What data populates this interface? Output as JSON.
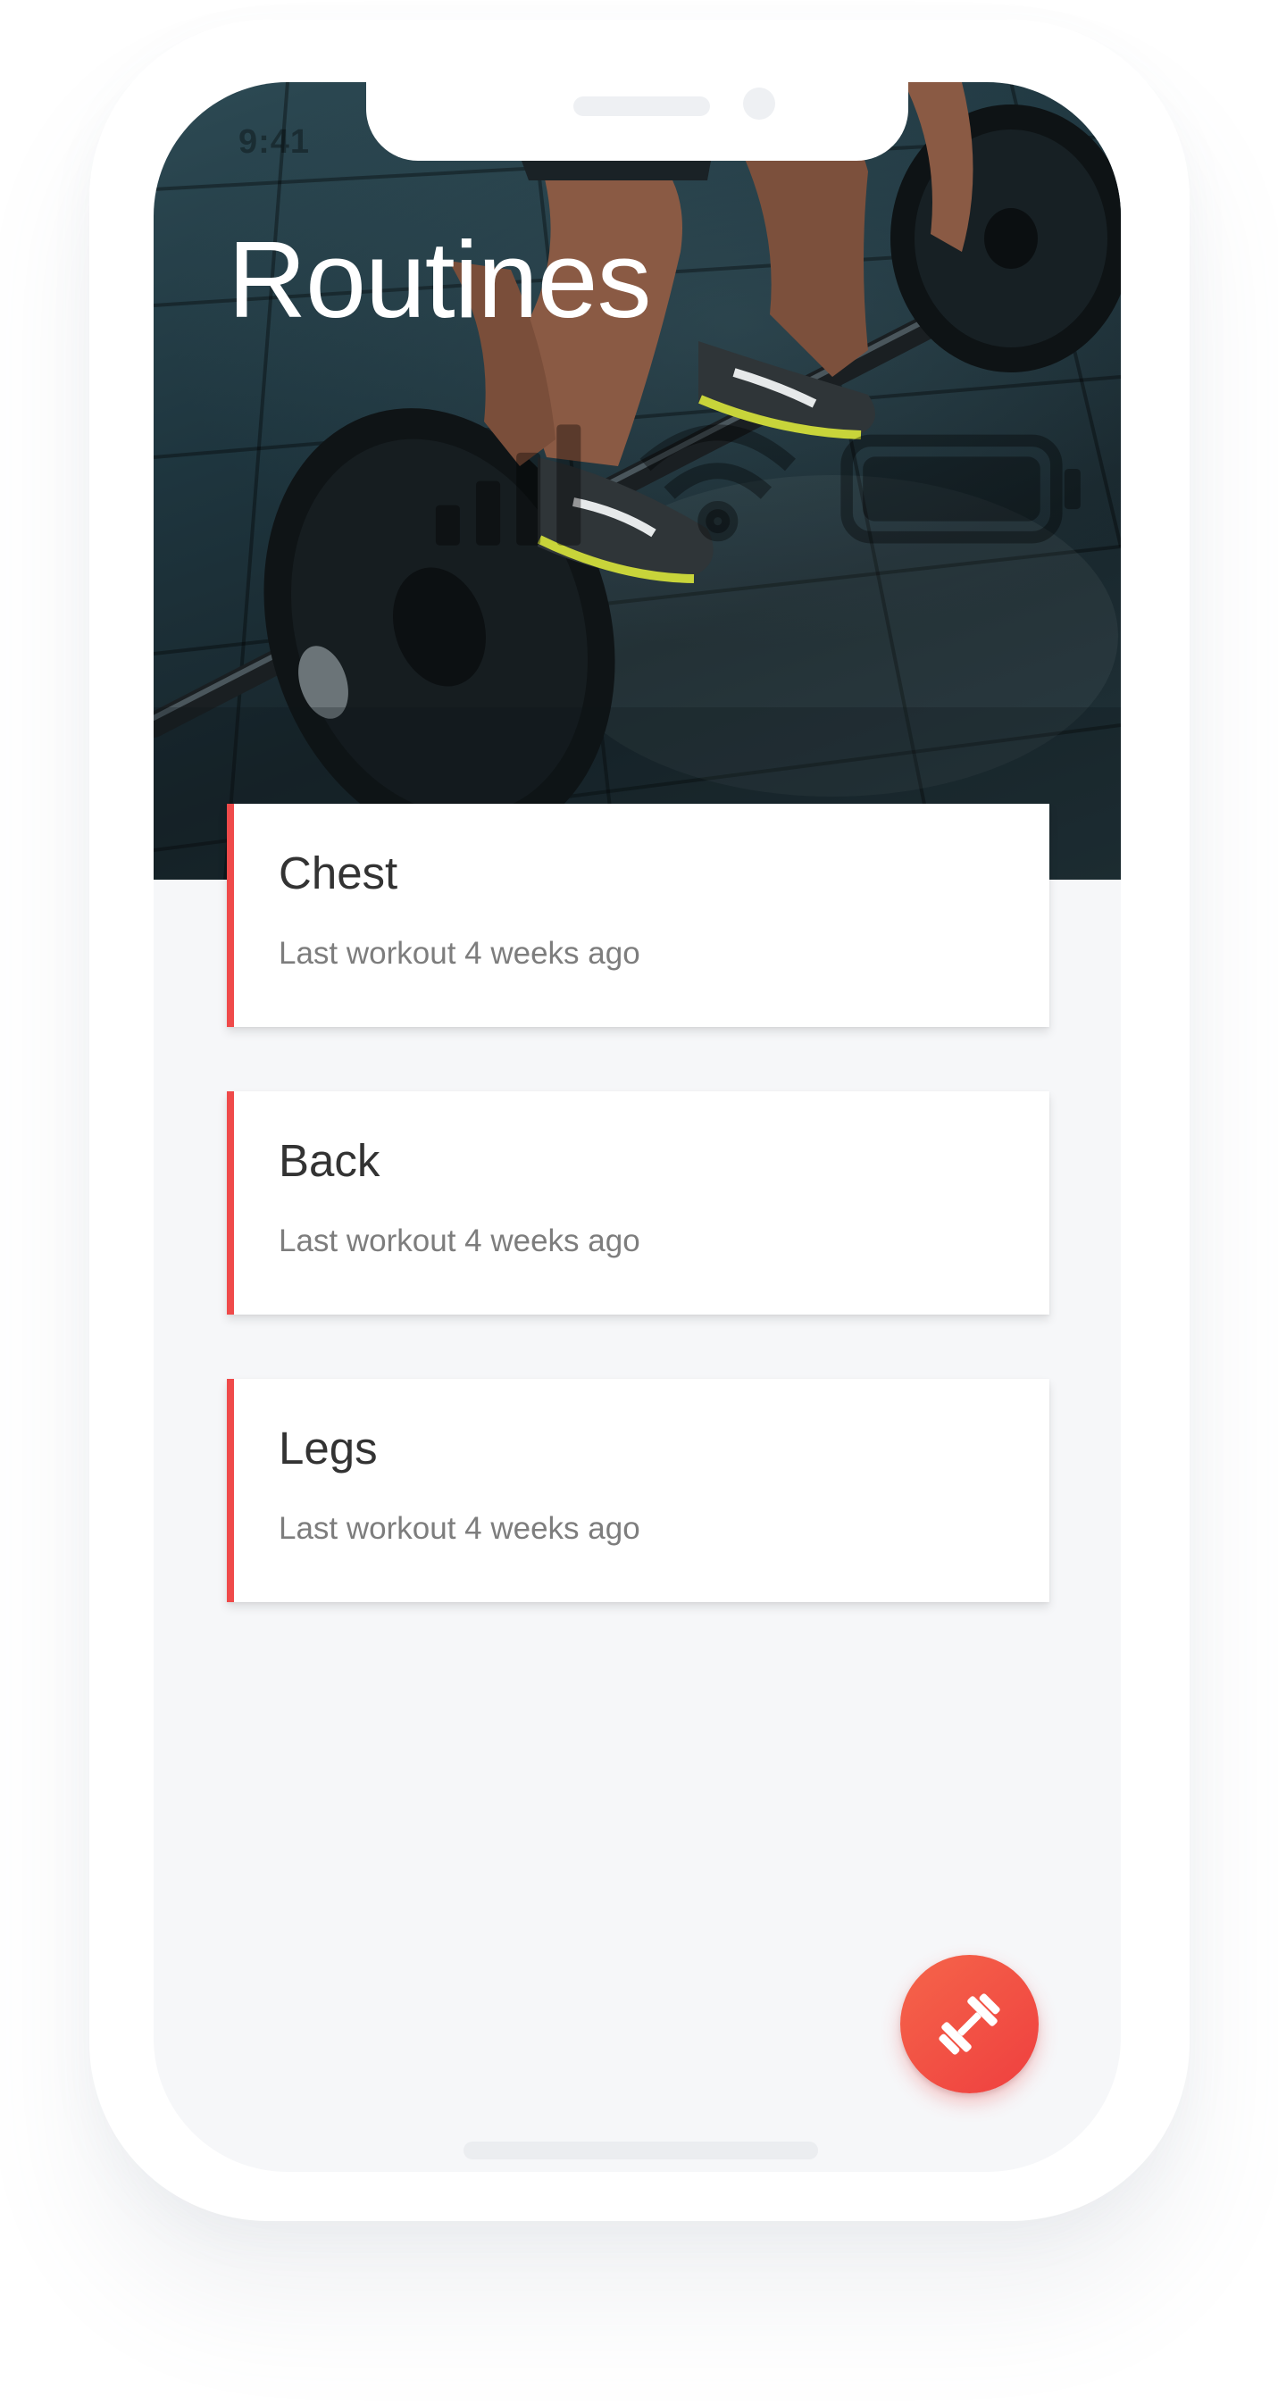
{
  "status_bar": {
    "time": "9:41"
  },
  "header": {
    "title": "Routines"
  },
  "routines": [
    {
      "name": "Chest",
      "last_workout": "Last workout 4 weeks ago"
    },
    {
      "name": "Back",
      "last_workout": "Last workout 4 weeks ago"
    },
    {
      "name": "Legs",
      "last_workout": "Last workout 4 weeks ago"
    }
  ],
  "fab": {
    "icon": "dumbbell-icon"
  },
  "colors": {
    "accent": "#ef4a4a",
    "fab_start": "#f5654a",
    "fab_end": "#ef3f3f",
    "background": "#f6f7f9",
    "card_title": "#333333",
    "card_subtitle": "#7d7d7d"
  }
}
